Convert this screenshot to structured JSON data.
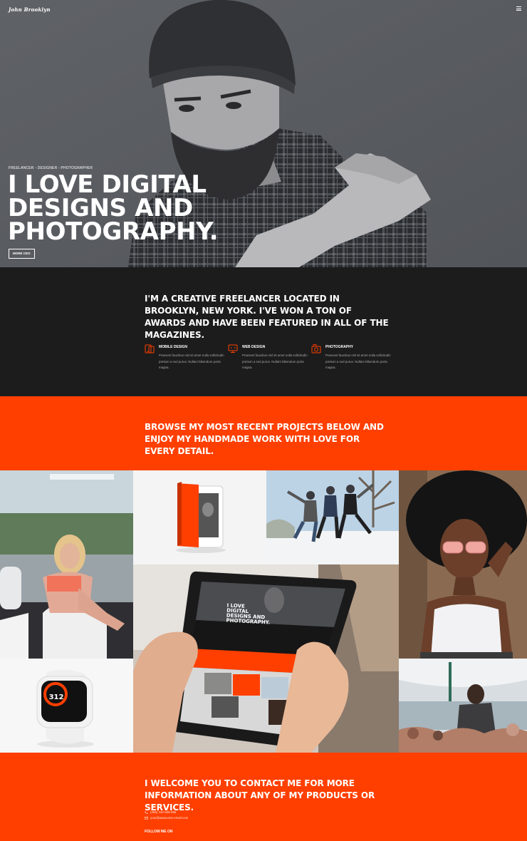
{
  "header": {
    "logo": "John Brooklyn",
    "menu_icon": "hamburger-menu-icon"
  },
  "hero": {
    "tagline": "FREELANCER - DESIGNER - PHOTOGRAPHER",
    "title_line1": "I LOVE DIGITAL",
    "title_line2": "DESIGNS AND",
    "title_line3": "PHOTOGRAPHY.",
    "button_label": "MORE CEO"
  },
  "about": {
    "heading": "I'M A CREATIVE FREELANCER LOCATED IN BROOKLYN, NEW YORK. I'VE WON A TON OF AWARDS AND HAVE BEEN FEATURED IN ALL OF THE MAGAZINES.",
    "services": [
      {
        "icon": "mobile-icon",
        "title": "MOBILE DESIGN",
        "text": "Praesent faucibus nisl sit amet nulla sollicitudin pretium a sed purus. Nullam bibendum porta magna."
      },
      {
        "icon": "monitor-icon",
        "title": "WEB DESIGN",
        "text": "Praesent faucibus nisl sit amet nulla sollicitudin pretium a sed purus. Nullam bibendum porta magna."
      },
      {
        "icon": "camera-icon",
        "title": "PHOTOGRAPHY",
        "text": "Praesent faucibus nisl sit amet nulla sollicitudin pretium a sed purus. Nullam bibendum porta magna."
      }
    ]
  },
  "projects": {
    "heading": "BROWSE MY MOST RECENT PROJECTS BELOW AND ENJOY MY HANDMADE WORK WITH LOVE FOR EVERY DETAIL."
  },
  "gallery": {
    "watch_value": "312",
    "tablet_screen_title": "I LOVE DIGITAL DESIGNS AND PHOTOGRAPHY."
  },
  "contact": {
    "heading": "I WELCOME YOU TO CONTACT ME FOR MORE INFORMATION ABOUT ANY OF MY PRODUCTS OR SERVICES.",
    "phone": "(256) 444-556-695",
    "email": "your@awesome-email.com",
    "follow_label": "FOLLOW ME ON"
  },
  "colors": {
    "accent": "#ff3f00",
    "dark": "#1c1c1c",
    "hero_bg": "#5a5d62"
  }
}
